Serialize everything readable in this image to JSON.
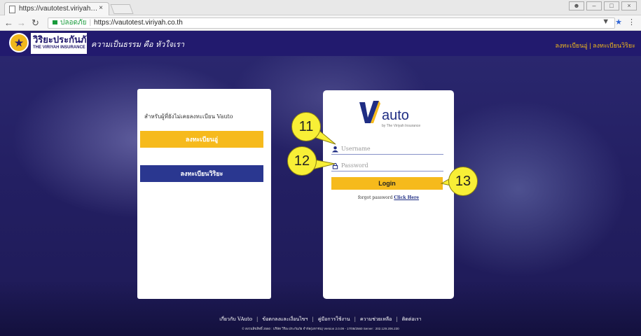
{
  "browser": {
    "tab_title": "https://vautotest.viriyah…",
    "tab_close": "×",
    "secure_label": "ปลอดภัย",
    "url": "https://vautotest.viriyah.co.th"
  },
  "header": {
    "logo_th": "วิริยะประกันภัย",
    "logo_en": "THE VIRIYAH INSURANCE",
    "slogan": "ความเป็นธรรม คือ หัวใจเรา",
    "top_links": "ลงทะเบียนอู่ | ลงทะเบียนวิริยะ"
  },
  "left_card": {
    "prompt": "สำหรับผู้ที่ยังไม่เคยลงทะเบียน Vauto",
    "register_garage": "ลงทะเบียนอู่",
    "register_viriyah": "ลงทะเบียนวิริยะ"
  },
  "right_card": {
    "logo_word": "auto",
    "logo_tagline": "by The Viriyah Insurance",
    "username_placeholder": "Username",
    "password_placeholder": "Password",
    "login_label": "Login",
    "forgot_text": "forgot password ",
    "forgot_link": "Click Here"
  },
  "callouts": {
    "username": "11",
    "password": "12",
    "login": "13"
  },
  "footer": {
    "links": [
      "เกี่ยวกับ VAuto",
      "ข้อตกลงและเงื่อนไขฯ",
      "คู่มือการใช้งาน",
      "ความช่วยเหลือ",
      "ติดต่อเรา"
    ],
    "separator": "|",
    "copyright": "© สงวนลิขสิทธิ์ 2560 : บริษัท วิริยะประกันภัย จำกัด(มหาชน) Version 2.0.09 - 17/08/2560 Server : 202.129.206.230"
  },
  "colors": {
    "brand_navy": "#221a6e",
    "accent_yellow": "#f6ba1c",
    "button_navy": "#2a3790"
  }
}
